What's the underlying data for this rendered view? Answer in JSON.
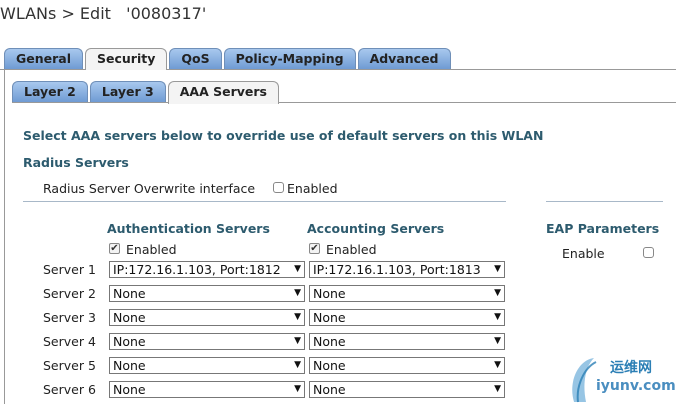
{
  "page_title": "WLANs > Edit   '0080317'",
  "main_tabs": [
    {
      "label": "General",
      "active": false
    },
    {
      "label": "Security",
      "active": true
    },
    {
      "label": "QoS",
      "active": false
    },
    {
      "label": "Policy-Mapping",
      "active": false
    },
    {
      "label": "Advanced",
      "active": false
    }
  ],
  "sub_tabs": [
    {
      "label": "Layer 2",
      "active": false
    },
    {
      "label": "Layer 3",
      "active": false
    },
    {
      "label": "AAA Servers",
      "active": true
    }
  ],
  "description": "Select AAA servers below to override use of default servers on this WLAN",
  "radius_section_title": "Radius Servers",
  "overwrite": {
    "label": "Radius Server Overwrite interface",
    "checkbox_label": "Enabled",
    "checked": false
  },
  "auth": {
    "heading": "Authentication Servers",
    "enabled_label": "Enabled",
    "checked": true
  },
  "acct": {
    "heading": "Accounting Servers",
    "enabled_label": "Enabled",
    "checked": true
  },
  "eap": {
    "heading": "EAP Parameters",
    "enable_label": "Enable",
    "checked": false
  },
  "servers": [
    {
      "label": "Server 1",
      "auth": "IP:172.16.1.103, Port:1812",
      "acct": "IP:172.16.1.103, Port:1813"
    },
    {
      "label": "Server 2",
      "auth": "None",
      "acct": "None"
    },
    {
      "label": "Server 3",
      "auth": "None",
      "acct": "None"
    },
    {
      "label": "Server 4",
      "auth": "None",
      "acct": "None"
    },
    {
      "label": "Server 5",
      "auth": "None",
      "acct": "None"
    },
    {
      "label": "Server 6",
      "auth": "None",
      "acct": "None"
    }
  ],
  "watermark": {
    "cn": "运维网",
    "en": "iyunv.com"
  },
  "colors": {
    "tab_gradient_top": "#a8c8ee",
    "tab_gradient_bottom": "#6f9bd3",
    "heading": "#2d5b6e"
  }
}
